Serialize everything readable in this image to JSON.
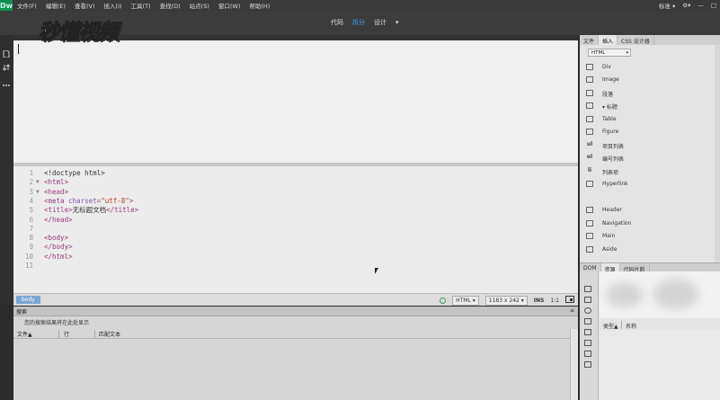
{
  "app": {
    "logo_text": "Dw"
  },
  "menu": {
    "items": [
      "文件(F)",
      "编辑(E)",
      "查看(V)",
      "插入(I)",
      "工具(T)",
      "查找(D)",
      "站点(S)",
      "窗口(W)",
      "帮助(H)"
    ],
    "right_label": "标准",
    "right_arrow": "▾",
    "gear_glyph": "⚙",
    "gear_caret": "▾",
    "minimize": "—",
    "maximize": "□"
  },
  "view_tabs": {
    "code": "代码",
    "split": "拆分",
    "design": "设计",
    "design_arrow": "▾"
  },
  "watermark": {
    "text": "秒懂视频"
  },
  "code_lines": [
    {
      "num": "1",
      "fold": "",
      "parts": [
        {
          "t": "txt",
          "v": "<!doctype html>"
        }
      ]
    },
    {
      "num": "2",
      "fold": "▼",
      "parts": [
        {
          "t": "tag",
          "v": "<html>"
        }
      ]
    },
    {
      "num": "3",
      "fold": "▼",
      "parts": [
        {
          "t": "tag",
          "v": "<head>"
        }
      ]
    },
    {
      "num": "4",
      "fold": "",
      "parts": [
        {
          "t": "tag",
          "v": "<meta "
        },
        {
          "t": "attr",
          "v": "charset"
        },
        {
          "t": "tag",
          "v": "="
        },
        {
          "t": "val",
          "v": "\"utf-8\""
        },
        {
          "t": "tag",
          "v": ">"
        }
      ]
    },
    {
      "num": "5",
      "fold": "",
      "parts": [
        {
          "t": "tag",
          "v": "<title>"
        },
        {
          "t": "txt",
          "v": "无标题文档"
        },
        {
          "t": "tag",
          "v": "</title>"
        }
      ]
    },
    {
      "num": "6",
      "fold": "",
      "parts": [
        {
          "t": "tag",
          "v": "</head>"
        }
      ]
    },
    {
      "num": "7",
      "fold": "",
      "parts": []
    },
    {
      "num": "8",
      "fold": "",
      "parts": [
        {
          "t": "tag",
          "v": "<body>"
        }
      ]
    },
    {
      "num": "9",
      "fold": "",
      "parts": [
        {
          "t": "tag",
          "v": "</body>"
        }
      ]
    },
    {
      "num": "10",
      "fold": "",
      "parts": [
        {
          "t": "tag",
          "v": "</html>"
        }
      ]
    },
    {
      "num": "11",
      "fold": "",
      "parts": []
    }
  ],
  "status": {
    "tag": "body",
    "doc_type": "HTML",
    "size": "1183 x 242",
    "mode": "INS",
    "position": "1:1"
  },
  "search_panel": {
    "tab": "搜索",
    "hint": "您的搜索结果将在此处显示",
    "col_file": "文件▲",
    "col_line": "行",
    "col_match": "匹配文本"
  },
  "right_panel": {
    "tabs": [
      "文件",
      "插入",
      "CSS 设计器"
    ],
    "select_value": "HTML",
    "insert_items": [
      {
        "icon": "div-icon",
        "glyph": "",
        "label": "Div"
      },
      {
        "icon": "image-icon",
        "glyph": "",
        "label": "Image"
      },
      {
        "icon": "paragraph-icon",
        "glyph": "",
        "label": "段落"
      },
      {
        "icon": "heading-icon",
        "glyph": "",
        "label": "▾ 标题"
      },
      {
        "icon": "table-icon",
        "glyph": "",
        "label": "Table"
      },
      {
        "icon": "figure-icon",
        "glyph": "",
        "label": "Figure"
      },
      {
        "icon": "unordered-list-icon",
        "glyph": "ul",
        "label": "项目列表"
      },
      {
        "icon": "ordered-list-icon",
        "glyph": "ol",
        "label": "编号列表"
      },
      {
        "icon": "list-item-icon",
        "glyph": "li",
        "label": "列表项"
      },
      {
        "icon": "hyperlink-icon",
        "glyph": "",
        "label": "Hyperlink"
      },
      {
        "icon": "header-icon",
        "glyph": "",
        "label": "Header"
      },
      {
        "icon": "navigation-icon",
        "glyph": "",
        "label": "Navigation"
      },
      {
        "icon": "main-icon",
        "glyph": "",
        "label": "Main"
      },
      {
        "icon": "aside-icon",
        "glyph": "",
        "label": "Aside"
      }
    ],
    "bottom_tabs": [
      "DOM",
      "资源",
      "代码片断"
    ],
    "assets_col_type": "类型▲",
    "assets_col_name": "名称"
  }
}
